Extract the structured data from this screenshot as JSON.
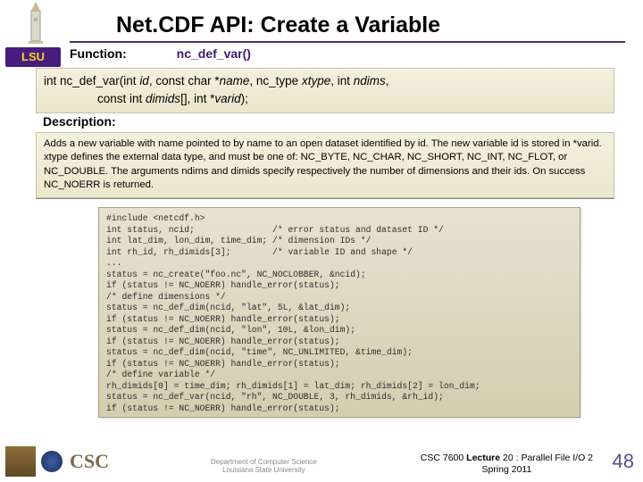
{
  "title": "Net.CDF API: Create a Variable",
  "lsu_text": "LSU",
  "function_row": {
    "label": "Function:",
    "name": "nc_def_var()"
  },
  "signature": {
    "line1_pre": "int nc_def_var(int ",
    "line1_id": "id",
    "line1_mid1": ", const char *",
    "line1_name": "name",
    "line1_mid2": ", nc_type ",
    "line1_xtype": "xtype",
    "line1_mid3": ", int ",
    "line1_ndims": "ndims",
    "line1_end": ",",
    "line2_pre": "                const int ",
    "line2_dimids": "dimids",
    "line2_mid": "[], int *",
    "line2_varid": "varid",
    "line2_end": ");"
  },
  "description_label": "Description:",
  "description_text": "Adds a new variable with name pointed to by name to an open dataset identified by id. The new variable id is stored in *varid. xtype defines the external data type, and must be one of: NC_BYTE, NC_CHAR, NC_SHORT, NC_INT, NC_FLOT, or NC_DOUBLE. The arguments ndims and dimids specify respectively the number of dimensions and their ids. On success NC_NOERR is returned.",
  "code": "#include <netcdf.h>\nint status, ncid;               /* error status and dataset ID */\nint lat_dim, lon_dim, time_dim; /* dimension IDs */\nint rh_id, rh_dimids[3];        /* variable ID and shape */\n...\nstatus = nc_create(\"foo.nc\", NC_NOCLOBBER, &ncid);\nif (status != NC_NOERR) handle_error(status);\n/* define dimensions */\nstatus = nc_def_dim(ncid, \"lat\", 5L, &lat_dim);\nif (status != NC_NOERR) handle_error(status);\nstatus = nc_def_dim(ncid, \"lon\", 10L, &lon_dim);\nif (status != NC_NOERR) handle_error(status);\nstatus = nc_def_dim(ncid, \"time\", NC_UNLIMITED, &time_dim);\nif (status != NC_NOERR) handle_error(status);\n/* define variable */\nrh_dimids[0] = time_dim; rh_dimids[1] = lat_dim; rh_dimids[2] = lon_dim;\nstatus = nc_def_var(ncid, \"rh\", NC_DOUBLE, 3, rh_dimids, &rh_id);\nif (status != NC_NOERR) handle_error(status);",
  "footer": {
    "csc": "CSC",
    "dept1": "Department of Computer Science",
    "dept2": "Louisiana State University",
    "lecture_line1_a": "CSC 7600 ",
    "lecture_line1_b": "Lecture",
    "lecture_line1_c": " 20 : Parallel File I/O 2",
    "lecture_line2": "Spring 2011",
    "page": "48"
  }
}
